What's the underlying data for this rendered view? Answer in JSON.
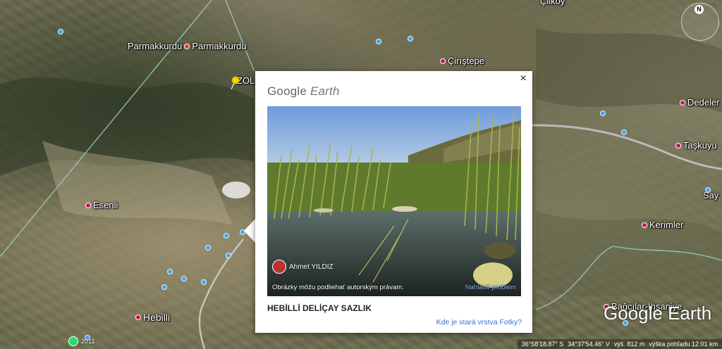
{
  "map": {
    "places": [
      {
        "name": "Parmakkurdu",
        "key": "parmakkurdu1"
      },
      {
        "name": "Parmakkurdu",
        "key": "parmakkurdu2"
      },
      {
        "name": "ZOL",
        "key": "zol"
      },
      {
        "name": "Çirıştepe",
        "key": "ciristepe"
      },
      {
        "name": "Çilköy",
        "key": "cilkoy"
      },
      {
        "name": "Dedeler",
        "key": "dedeler"
      },
      {
        "name": "Taşkuyu",
        "key": "taskuyu"
      },
      {
        "name": "Say",
        "key": "say"
      },
      {
        "name": "Kerimler",
        "key": "kerimler"
      },
      {
        "name": "Esenli",
        "key": "esenli"
      },
      {
        "name": "Hebilli",
        "key": "hebilli"
      },
      {
        "name": "Bağcılar-İhsaniye",
        "key": "bagcilar"
      }
    ],
    "compass_label": "N",
    "year_label": "2011",
    "watermark": "Google Earth",
    "status": {
      "lat": "36°58'18.87\" S",
      "lon": "34°37'54.46\" V",
      "elev": "výš.  812 m",
      "view": "výška pohľadu  12.01 km"
    }
  },
  "popup": {
    "logo_google": "Google",
    "logo_earth": "Earth",
    "close_label": "×",
    "photo_author": "Ahmet YILDIZ",
    "photo_copyright": "Obrázky môžu podliehať autorským právam.",
    "report_label": "Nahlásiť problém",
    "photo_title": "HEBİLLİ DELİÇAY SAZLIK",
    "old_layer_link": "Kde je stará vrstva Fotky?"
  }
}
